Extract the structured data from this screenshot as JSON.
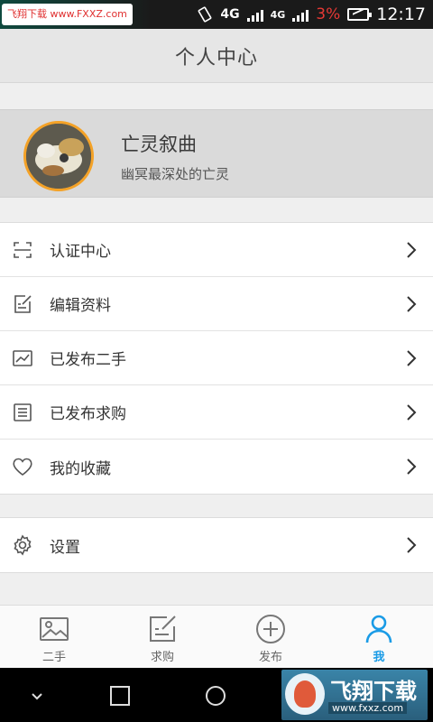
{
  "status_bar": {
    "watermark": "飞翔下载 www.FXXZ.com",
    "network": "4G",
    "network2": "4G",
    "battery_percent": "3%",
    "time": "12:17"
  },
  "header": {
    "title": "个人中心"
  },
  "profile": {
    "name": "亡灵叙曲",
    "bio": "幽冥最深处的亡灵"
  },
  "menu": [
    {
      "label": "认证中心",
      "icon": "scan-icon"
    },
    {
      "label": "编辑资料",
      "icon": "edit-icon"
    },
    {
      "label": "已发布二手",
      "icon": "chart-icon"
    },
    {
      "label": "已发布求购",
      "icon": "list-icon"
    },
    {
      "label": "我的收藏",
      "icon": "heart-icon"
    }
  ],
  "settings": {
    "label": "设置",
    "icon": "gear-icon"
  },
  "bottom_nav": [
    {
      "label": "二手",
      "icon": "image-icon",
      "active": false
    },
    {
      "label": "求购",
      "icon": "edit-icon",
      "active": false
    },
    {
      "label": "发布",
      "icon": "plus-circle-icon",
      "active": false
    },
    {
      "label": "我",
      "icon": "person-icon",
      "active": true
    }
  ],
  "watermark_bottom": {
    "title": "飞翔下载",
    "url": "www.fxxz.com"
  },
  "colors": {
    "accent": "#1a9be6",
    "avatar_ring": "#f4a227",
    "battery_low": "#e53935"
  }
}
